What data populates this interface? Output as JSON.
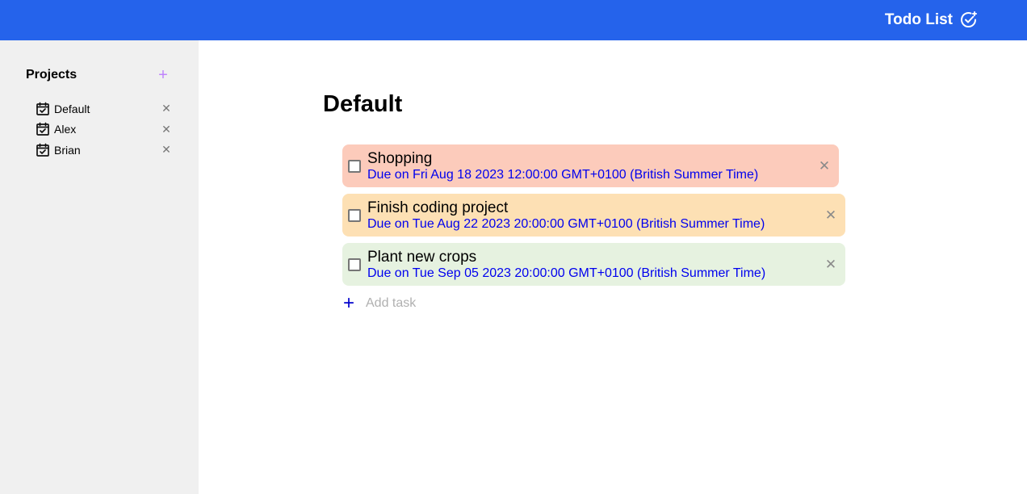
{
  "header": {
    "title": "Todo List",
    "icon": "check-badge-icon",
    "bg_color": "#2563eb"
  },
  "sidebar": {
    "title": "Projects",
    "add_label": "+",
    "delete_label": "✕",
    "projects": [
      {
        "name": "Default",
        "icon": "calendar-check-icon"
      },
      {
        "name": "Alex",
        "icon": "calendar-check-icon"
      },
      {
        "name": "Brian",
        "icon": "calendar-check-icon"
      }
    ]
  },
  "main": {
    "project_title": "Default",
    "tasks": [
      {
        "name": "Shopping",
        "due": "Due on Fri Aug 18 2023 12:00:00 GMT+0100 (British Summer Time)",
        "color": "#fccbbb",
        "checked": false
      },
      {
        "name": "Finish coding project",
        "due": "Due on Tue Aug 22 2023 20:00:00 GMT+0100 (British Summer Time)",
        "color": "#fde0b4",
        "checked": false
      },
      {
        "name": "Plant new crops",
        "due": "Due on Tue Sep 05 2023 20:00:00 GMT+0100 (British Summer Time)",
        "color": "#e6f2e0",
        "checked": false
      }
    ],
    "delete_label": "✕",
    "add_task": {
      "plus_label": "+",
      "placeholder": "Add task",
      "value": ""
    }
  }
}
